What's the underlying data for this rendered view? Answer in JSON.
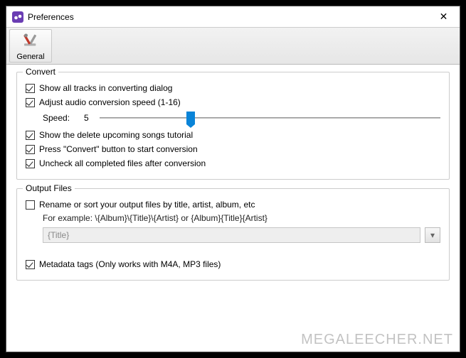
{
  "window": {
    "title": "Preferences",
    "close_glyph": "✕"
  },
  "toolbar": {
    "general_label": "General"
  },
  "convert": {
    "group_title": "Convert",
    "show_all_tracks": {
      "label": "Show all tracks in converting dialog",
      "checked": true
    },
    "adjust_speed": {
      "label": "Adjust audio conversion speed (1-16)",
      "checked": true
    },
    "speed_label": "Speed:",
    "speed_value": "5",
    "show_delete_tutorial": {
      "label": "Show the delete upcoming songs tutorial",
      "checked": true
    },
    "press_convert": {
      "label": "Press \"Convert\" button to start conversion",
      "checked": true
    },
    "uncheck_completed": {
      "label": "Uncheck all completed files after conversion",
      "checked": true
    }
  },
  "output": {
    "group_title": "Output Files",
    "rename": {
      "label": "Rename or sort your output files by title, artist, album, etc",
      "checked": false
    },
    "example_text": "For example: \\{Album}\\{Title}\\{Artist} or {Album}{Title}{Artist}",
    "pattern_placeholder": "{Title}",
    "dropdown_glyph": "▾",
    "metadata": {
      "label": "Metadata tags (Only works with M4A, MP3 files)",
      "checked": true
    }
  },
  "watermark": "MEGALEECHER.NET"
}
